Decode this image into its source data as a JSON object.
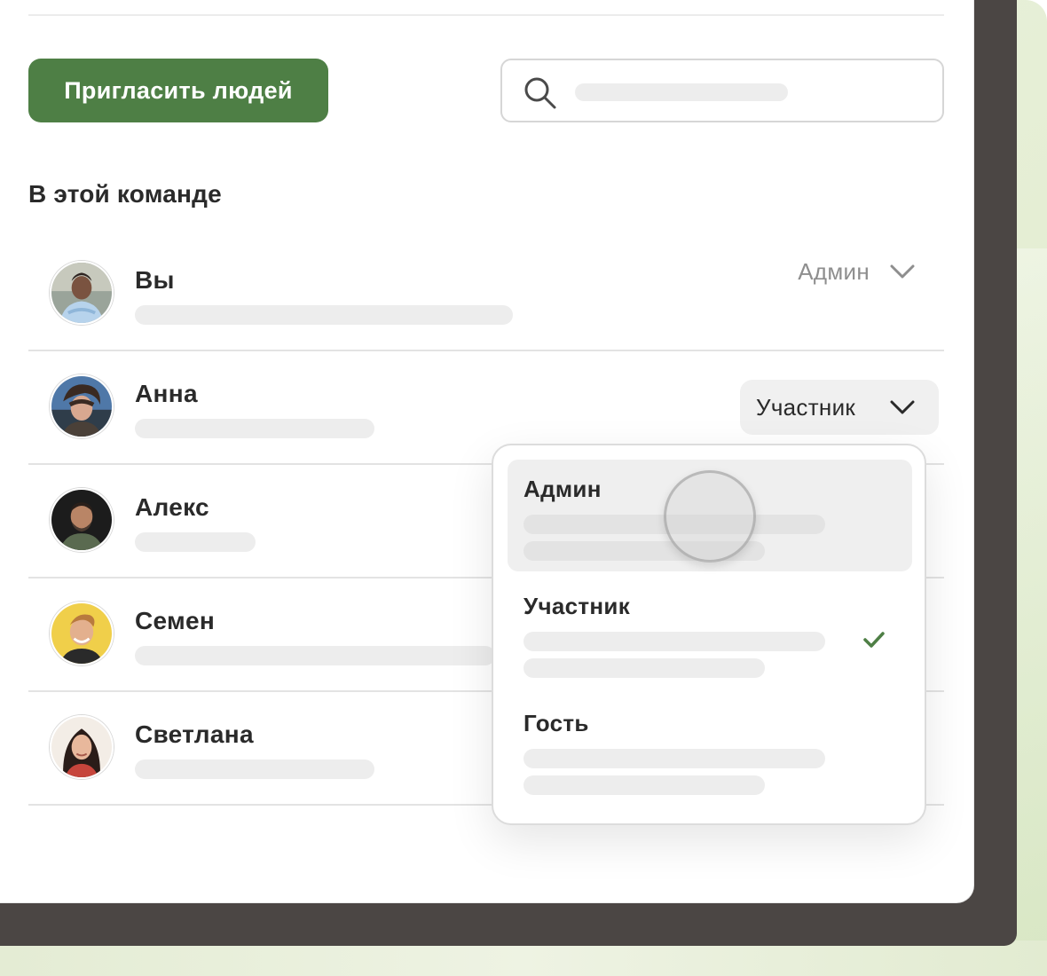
{
  "toolbar": {
    "invite_label": "Пригласить людей",
    "search_placeholder": ""
  },
  "section": {
    "title": "В этой команде"
  },
  "members": [
    {
      "name": "Вы",
      "role": "Админ",
      "avatar": "avatar-you"
    },
    {
      "name": "Анна",
      "role": "Участник",
      "avatar": "avatar-anna"
    },
    {
      "name": "Алекс",
      "role": "",
      "avatar": "avatar-alex"
    },
    {
      "name": "Семен",
      "role": "",
      "avatar": "avatar-semen"
    },
    {
      "name": "Светлана",
      "role": "",
      "avatar": "avatar-svetlana"
    }
  ],
  "role_menu": {
    "options": [
      {
        "label": "Админ",
        "state": "hovered"
      },
      {
        "label": "Участник",
        "state": "selected"
      },
      {
        "label": "Гость",
        "state": "default"
      }
    ]
  },
  "colors": {
    "accent": "#4e7f45",
    "frame": "#4b4644",
    "background_tint": "#e6efd6"
  },
  "icons": [
    "search-icon",
    "chevron-down-icon",
    "check-icon"
  ]
}
